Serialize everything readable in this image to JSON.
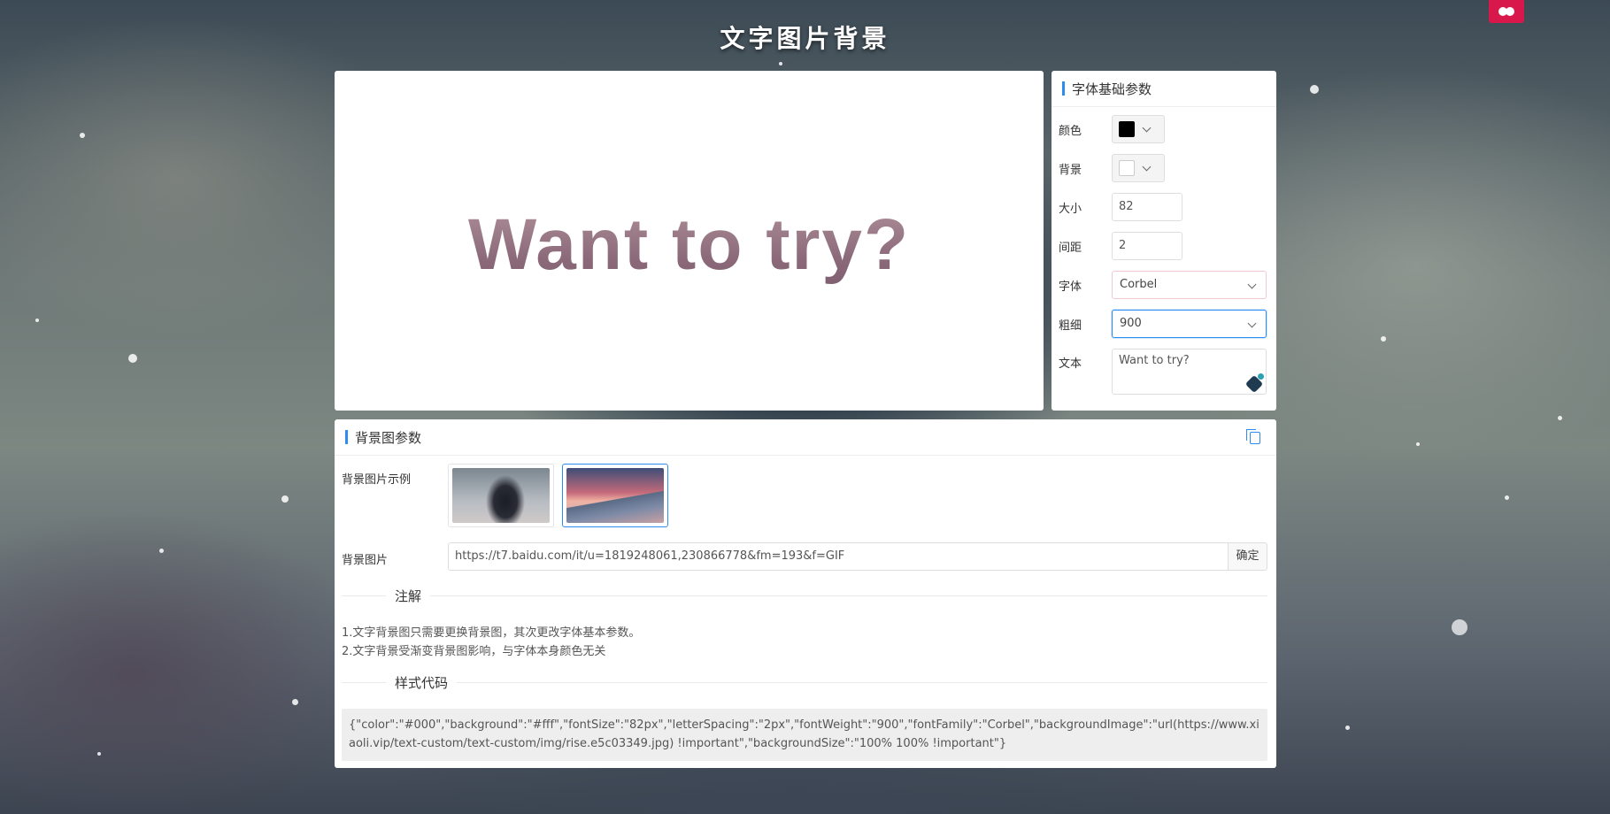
{
  "header": {
    "title": "文字图片背景"
  },
  "preview": {
    "text": "Want to try?"
  },
  "params": {
    "heading": "字体基础参数",
    "color_label": "颜色",
    "color_value": "#000000",
    "background_label": "背景",
    "background_value": "#ffffff",
    "size_label": "大小",
    "size_value": "82",
    "spacing_label": "间距",
    "spacing_value": "2",
    "font_label": "字体",
    "font_value": "Corbel",
    "weight_label": "粗细",
    "weight_value": "900",
    "text_label": "文本",
    "text_value": "Want to try?"
  },
  "bg_params": {
    "heading": "背景图参数",
    "examples_label": "背景图片示例",
    "image_label": "背景图片",
    "image_url": "https://t7.baidu.com/it/u=1819248061,230866778&fm=193&f=GIF",
    "confirm_label": "确定",
    "notes_title": "注解",
    "notes": [
      "1.文字背景图只需要更换背景图，其次更改字体基本参数。",
      "2.文字背景受渐变背景图影响，与字体本身颜色无关"
    ],
    "code_title": "样式代码",
    "code": "{\"color\":\"#000\",\"background\":\"#fff\",\"fontSize\":\"82px\",\"letterSpacing\":\"2px\",\"fontWeight\":\"900\",\"fontFamily\":\"Corbel\",\"backgroundImage\":\"url(https://www.xiaoli.vip/text-custom/text-custom/img/rise.e5c03349.jpg) !important\",\"backgroundSize\":\"100% 100% !important\"}"
  },
  "icons": {
    "corner_logo": "cluster-logo-icon",
    "copy": "copy-icon",
    "textarea_badge": "assistant-badge-icon"
  },
  "colors": {
    "accent": "#2d8cf0",
    "logo": "#d8174a"
  }
}
